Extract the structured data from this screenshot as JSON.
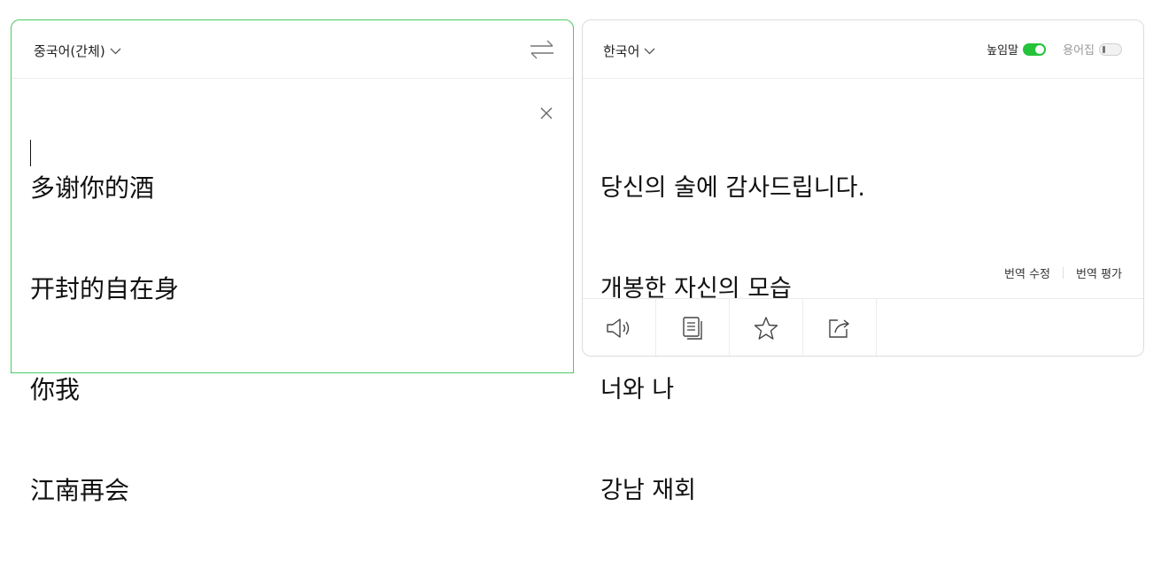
{
  "source": {
    "language": "중국어(간체)",
    "lines": [
      "多谢你的酒",
      "开封的自在身",
      "你我",
      "江南再会"
    ]
  },
  "target": {
    "language": "한국어",
    "honorific_label": "높임말",
    "honorific_on": true,
    "glossary_label": "용어집",
    "glossary_on": false,
    "lines": [
      "당신의 술에 감사드립니다.",
      "개봉한 자신의 모습",
      "너와 나",
      "강남 재회"
    ],
    "edit_label": "번역 수정",
    "rate_label": "번역 평가"
  },
  "icons": {
    "swap": "swap-arrows-icon",
    "clear": "close-icon",
    "speaker": "speaker-icon",
    "copy": "copy-icon",
    "favorite": "star-icon",
    "share": "share-icon"
  },
  "colors": {
    "accent": "#25c33a",
    "active_border": "#4cc964"
  }
}
